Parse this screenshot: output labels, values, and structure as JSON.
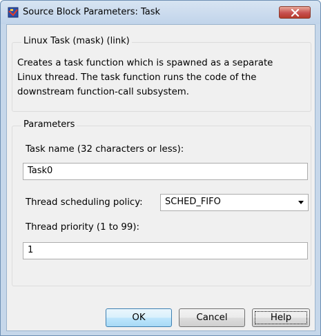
{
  "window": {
    "title": "Source Block Parameters: Task"
  },
  "mask": {
    "group_title": "Linux Task (mask) (link)",
    "description": "Creates a task function which is spawned as a separate Linux thread. The task function runs the code of the downstream function-call subsystem."
  },
  "parameters": {
    "group_title": "Parameters",
    "task_name_label": "Task name (32 characters or less):",
    "task_name_value": "Task0",
    "policy_label": "Thread scheduling policy:",
    "policy_value": "SCHED_FIFO",
    "priority_label": "Thread priority (1 to 99):",
    "priority_value": "1"
  },
  "buttons": {
    "ok": "OK",
    "cancel": "Cancel",
    "help": "Help"
  },
  "colors": {
    "window_frame": "#c6d7ea",
    "close_button": "#c75050",
    "default_button": "#bee6fd"
  }
}
